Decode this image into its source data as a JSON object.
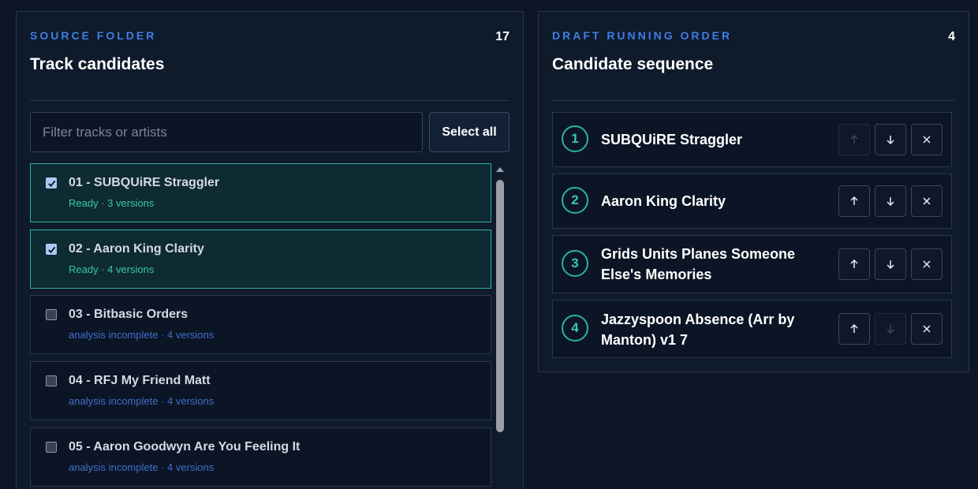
{
  "source": {
    "kicker": "SOURCE FOLDER",
    "count": "17",
    "heading": "Track candidates",
    "filter_placeholder": "Filter tracks or artists",
    "select_all_label": "Select all",
    "tracks": [
      {
        "title": "01 - SUBQUiRE Straggler",
        "meta": "Ready · 3 versions",
        "checked": true
      },
      {
        "title": "02 - Aaron King Clarity",
        "meta": "Ready · 4 versions",
        "checked": true
      },
      {
        "title": "03 - Bitbasic Orders",
        "meta": "analysis incomplete · 4 versions",
        "checked": false
      },
      {
        "title": "04 - RFJ My Friend Matt",
        "meta": "analysis incomplete · 4 versions",
        "checked": false
      },
      {
        "title": "05 - Aaron Goodwyn Are You Feeling It",
        "meta": "analysis incomplete · 4 versions",
        "checked": false
      }
    ]
  },
  "running_order": {
    "kicker": "DRAFT RUNNING ORDER",
    "count": "4",
    "heading": "Candidate sequence",
    "items": [
      {
        "number": "1",
        "title": "SUBQUiRE Straggler",
        "up_enabled": false,
        "down_enabled": true
      },
      {
        "number": "2",
        "title": "Aaron King Clarity",
        "up_enabled": true,
        "down_enabled": true
      },
      {
        "number": "3",
        "title": "Grids Units Planes Someone Else's Memories",
        "up_enabled": true,
        "down_enabled": true
      },
      {
        "number": "4",
        "title": "Jazzyspoon Absence (Arr by Manton) v1 7",
        "up_enabled": true,
        "down_enabled": false
      }
    ]
  },
  "icons": {
    "up": "arrow-up-icon",
    "down": "arrow-down-icon",
    "remove": "close-icon",
    "check": "checkmark-icon"
  },
  "colors": {
    "background": "#0d1626",
    "accent_blue": "#3f7fe6",
    "accent_teal": "#39c8a8"
  }
}
